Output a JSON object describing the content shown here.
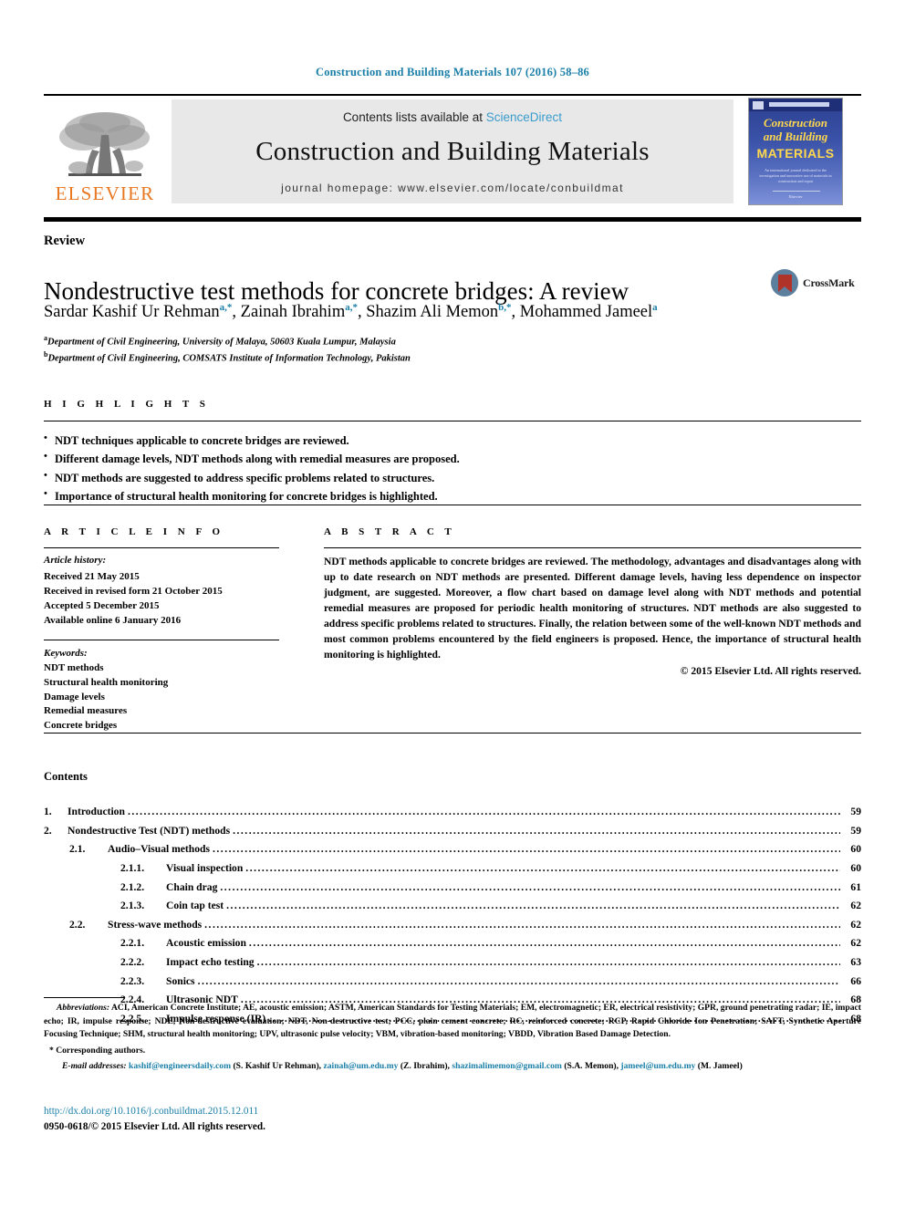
{
  "running_head": "Construction and Building Materials 107 (2016) 58–86",
  "masthead": {
    "publisher_name": "ELSEVIER",
    "contents_prefix": "Contents lists available at ",
    "contents_link": "ScienceDirect",
    "journal_title": "Construction and Building Materials",
    "homepage": "journal homepage: www.elsevier.com/locate/conbuildmat",
    "cover": {
      "line1": "Construction",
      "line2": "and Building",
      "line3": "MATERIALS",
      "blurb": "An international journal dedicated to the investigation and innovative use of materials in construction and repair",
      "footer": "Elsevier"
    }
  },
  "article": {
    "type": "Review",
    "title": "Nondestructive test methods for concrete bridges: A review",
    "authors": [
      {
        "name": "Sardar Kashif Ur Rehman",
        "marks": "a,*"
      },
      {
        "name": "Zainah Ibrahim",
        "marks": "a,*"
      },
      {
        "name": "Shazim Ali Memon",
        "marks": "b,*"
      },
      {
        "name": "Mohammed Jameel",
        "marks": "a"
      }
    ],
    "affiliations": [
      {
        "mark": "a",
        "text": "Department of Civil Engineering, University of Malaya, 50603 Kuala Lumpur, Malaysia"
      },
      {
        "mark": "b",
        "text": "Department of Civil Engineering, COMSATS Institute of Information Technology, Pakistan"
      }
    ],
    "crossmark_label": "CrossMark"
  },
  "highlights": {
    "heading": "H I G H L I G H T S",
    "items": [
      "NDT techniques applicable to concrete bridges are reviewed.",
      "Different damage levels, NDT methods along with remedial measures are proposed.",
      "NDT methods are suggested to address specific problems related to structures.",
      "Importance of structural health monitoring for concrete bridges is highlighted."
    ]
  },
  "article_info": {
    "heading": "A R T I C L E   I N F O",
    "history_label": "Article history:",
    "history": [
      "Received 21 May 2015",
      "Received in revised form 21 October 2015",
      "Accepted 5 December 2015",
      "Available online 6 January 2016"
    ],
    "keywords_label": "Keywords:",
    "keywords": [
      "NDT methods",
      "Structural health monitoring",
      "Damage levels",
      "Remedial measures",
      "Concrete bridges"
    ]
  },
  "abstract": {
    "heading": "A B S T R A C T",
    "text": "NDT methods applicable to concrete bridges are reviewed. The methodology, advantages and disadvantages along with up to date research on NDT methods are presented. Different damage levels, having less dependence on inspector judgment, are suggested. Moreover, a flow chart based on damage level along with NDT methods and potential remedial measures are proposed for periodic health monitoring of structures. NDT methods are also suggested to address specific problems related to structures. Finally, the relation between some of the well-known NDT methods and most common problems encountered by the field engineers is proposed. Hence, the importance of structural health monitoring is highlighted.",
    "copyright": "© 2015 Elsevier Ltd. All rights reserved."
  },
  "contents": {
    "heading": "Contents",
    "entries": [
      {
        "level": 1,
        "num": "1.",
        "label": "Introduction",
        "page": "59"
      },
      {
        "level": 1,
        "num": "2.",
        "label": "Nondestructive Test (NDT) methods",
        "page": "59"
      },
      {
        "level": 2,
        "num": "2.1.",
        "label": "Audio–Visual methods",
        "page": "60"
      },
      {
        "level": 3,
        "num": "2.1.1.",
        "label": "Visual inspection",
        "page": "60"
      },
      {
        "level": 3,
        "num": "2.1.2.",
        "label": "Chain drag",
        "page": "61"
      },
      {
        "level": 3,
        "num": "2.1.3.",
        "label": "Coin tap test",
        "page": "62"
      },
      {
        "level": 2,
        "num": "2.2.",
        "label": "Stress-wave methods",
        "page": "62"
      },
      {
        "level": 3,
        "num": "2.2.1.",
        "label": "Acoustic emission",
        "page": "62"
      },
      {
        "level": 3,
        "num": "2.2.2.",
        "label": "Impact echo testing",
        "page": "63"
      },
      {
        "level": 3,
        "num": "2.2.3.",
        "label": "Sonics",
        "page": "66"
      },
      {
        "level": 3,
        "num": "2.2.4.",
        "label": "Ultrasonic NDT",
        "page": "68"
      },
      {
        "level": 3,
        "num": "2.2.5.",
        "label": "Impulse response (IR)",
        "page": "68"
      }
    ]
  },
  "footnotes": {
    "abbreviations_label": "Abbreviations:",
    "abbreviations_text": " ACI, American Concrete Institute; AE, acoustic emission; ASTM, American Standards for Testing Materials; EM, electromagnetic; ER, electrical resistivity; GPR, ground penetrating radar; IE, impact echo; IR, impulse response; NDE, Non-destructive evaluation; NDT, Non-destructive test; PCC, plain cement concrete; RC, reinforced concrete; RCP, Rapid Chloride Ion Penetration; SAFT, Synthetic Aperture Focusing Technique; SHM, structural health monitoring; UPV, ultrasonic pulse velocity; VBM, vibration-based monitoring; VBDD, Vibration Based Damage Detection.",
    "corresponding": "* Corresponding authors.",
    "email_label": "E-mail addresses:",
    "emails": [
      {
        "address": "kashif@engineersdaily.com",
        "who": "(S. Kashif Ur Rehman)"
      },
      {
        "address": "zainah@um.edu.my",
        "who": "(Z. Ibrahim)"
      },
      {
        "address": "shazimalimemon@gmail.com",
        "who": "(S.A. Memon)"
      },
      {
        "address": "jameel@um.edu.my",
        "who": "(M. Jameel)"
      }
    ]
  },
  "doi": "http://dx.doi.org/10.1016/j.conbuildmat.2015.12.011",
  "issn_line": "0950-0618/© 2015 Elsevier Ltd. All rights reserved.",
  "colors": {
    "link_blue": "#1a7fa8",
    "sciencedirect_blue": "#3a9ccd",
    "elsevier_orange": "#E87722",
    "cover_blue": "#3a52a8",
    "cover_yellow": "#ffd84d"
  }
}
